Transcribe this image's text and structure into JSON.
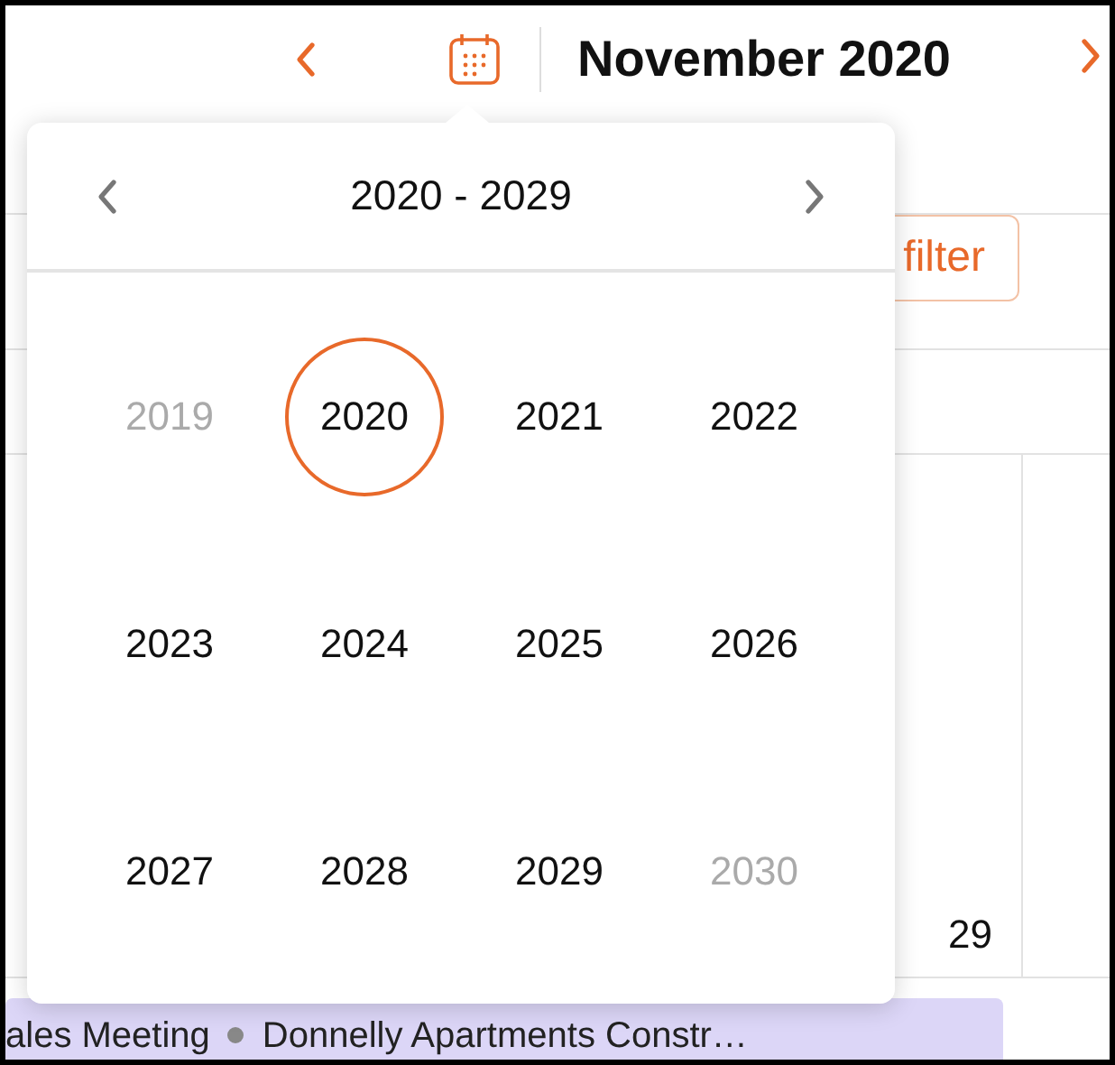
{
  "header": {
    "title": "November 2020"
  },
  "toolbar": {
    "filter_button": "filter"
  },
  "calendar": {
    "day_number": "29",
    "events": [
      "ales Meeting",
      "Donnelly Apartments Constr…"
    ]
  },
  "year_picker": {
    "range": "2020 - 2029",
    "years": [
      {
        "label": "2019",
        "selected": false,
        "disabled": true
      },
      {
        "label": "2020",
        "selected": true,
        "disabled": false
      },
      {
        "label": "2021",
        "selected": false,
        "disabled": false
      },
      {
        "label": "2022",
        "selected": false,
        "disabled": false
      },
      {
        "label": "2023",
        "selected": false,
        "disabled": false
      },
      {
        "label": "2024",
        "selected": false,
        "disabled": false
      },
      {
        "label": "2025",
        "selected": false,
        "disabled": false
      },
      {
        "label": "2026",
        "selected": false,
        "disabled": false
      },
      {
        "label": "2027",
        "selected": false,
        "disabled": false
      },
      {
        "label": "2028",
        "selected": false,
        "disabled": false
      },
      {
        "label": "2029",
        "selected": false,
        "disabled": false
      },
      {
        "label": "2030",
        "selected": false,
        "disabled": true
      }
    ]
  }
}
